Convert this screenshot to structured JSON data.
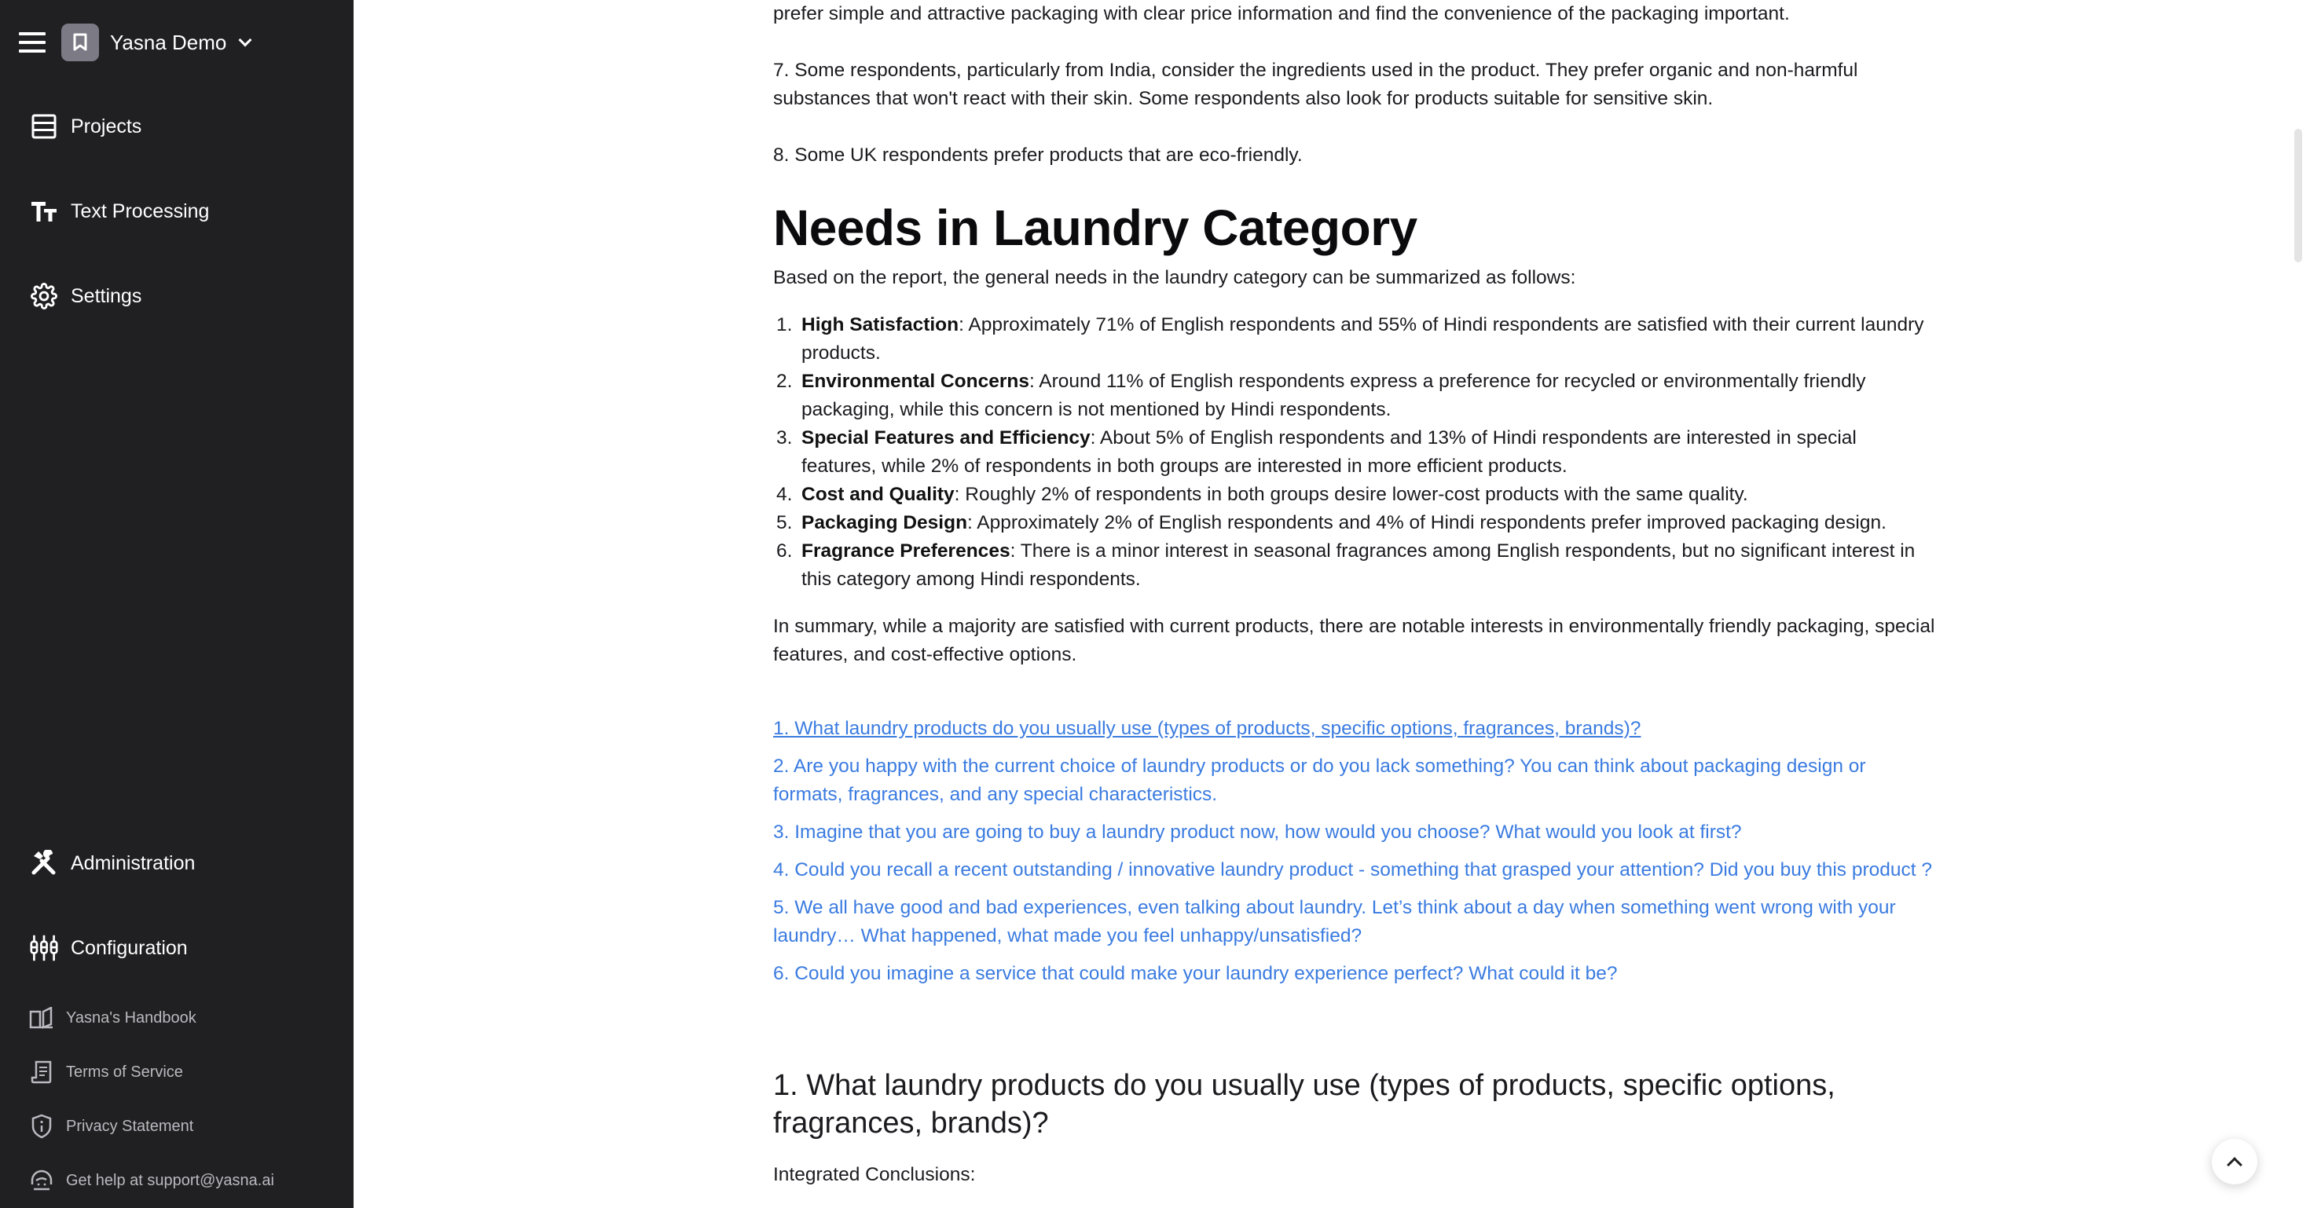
{
  "sidebar": {
    "workspace_name": "Yasna Demo",
    "nav": [
      {
        "label": "Projects",
        "icon": "table-icon"
      },
      {
        "label": "Text Processing",
        "icon": "text-size-icon"
      },
      {
        "label": "Settings",
        "icon": "gear-icon"
      }
    ],
    "admin": [
      {
        "label": "Administration",
        "icon": "tools-icon"
      },
      {
        "label": "Configuration",
        "icon": "sliders-icon"
      }
    ],
    "footer": [
      {
        "label": "Yasna's Handbook",
        "icon": "book-icon"
      },
      {
        "label": "Terms of Service",
        "icon": "document-icon"
      },
      {
        "label": "Privacy Statement",
        "icon": "shield-info-icon"
      },
      {
        "label": "Get help at support@yasna.ai",
        "icon": "headset-icon"
      }
    ]
  },
  "content": {
    "top_paragraphs": [
      "prefer simple and attractive packaging with clear price information and find the convenience of the packaging important.",
      "7. Some respondents, particularly from India, consider the ingredients used in the product. They prefer organic and non-harmful substances that won't react with their skin. Some respondents also look for products suitable for sensitive skin.",
      "8. Some UK respondents prefer products that are eco-friendly."
    ],
    "heading": "Needs in Laundry Category",
    "intro": "Based on the report, the general needs in the laundry category can be summarized as follows:",
    "needs": [
      {
        "num": "1.",
        "title": "High Satisfaction",
        "text": ": Approximately 71% of English respondents and 55% of Hindi respondents are satisfied with their current laundry products."
      },
      {
        "num": "2.",
        "title": "Environmental Concerns",
        "text": ": Around 11% of English respondents express a preference for recycled or environmentally friendly packaging, while this concern is not mentioned by Hindi respondents."
      },
      {
        "num": "3.",
        "title": "Special Features and Efficiency",
        "text": ": About 5% of English respondents and 13% of Hindi respondents are interested in special features, while 2% of respondents in both groups are interested in more efficient products."
      },
      {
        "num": "4.",
        "title": "Cost and Quality",
        "text": ": Roughly 2% of respondents in both groups desire lower-cost products with the same quality."
      },
      {
        "num": "5.",
        "title": "Packaging Design",
        "text": ": Approximately 2% of English respondents and 4% of Hindi respondents prefer improved packaging design."
      },
      {
        "num": "6.",
        "title": "Fragrance Preferences",
        "text": ": There is a minor interest in seasonal fragrances among English respondents, but no significant interest in this category among Hindi respondents."
      }
    ],
    "summary": "In summary, while a majority are satisfied with current products, there are notable interests in environmentally friendly packaging, special features, and cost-effective options.",
    "questions": [
      "1. What laundry products do you usually use (types of products, specific options, fragrances, brands)?",
      "2. Are you happy with the current choice of laundry products or do you lack something? You can think about packaging design or formats, fragrances, and any special characteristics.",
      "3. Imagine that you are going to buy a laundry product now, how would you choose? What would you look at first?",
      "4. Could you recall a recent outstanding / innovative laundry product - something that grasped your attention? Did you buy this product ?",
      "5. We all have good and bad experiences, even talking about laundry. Let’s think about a day when something went wrong with your laundry… What happened, what made you feel unhappy/unsatisfied?",
      "6. Could you imagine a service that could make your laundry experience perfect? What could it be?"
    ],
    "section_heading": "1. What laundry products do you usually use (types of products, specific options, fragrances, brands)?",
    "section_subtitle": "Integrated Conclusions:"
  },
  "colors": {
    "sidebar_bg": "#202022",
    "link": "#3a7be0",
    "workspace_avatar": "#7b7a85"
  }
}
